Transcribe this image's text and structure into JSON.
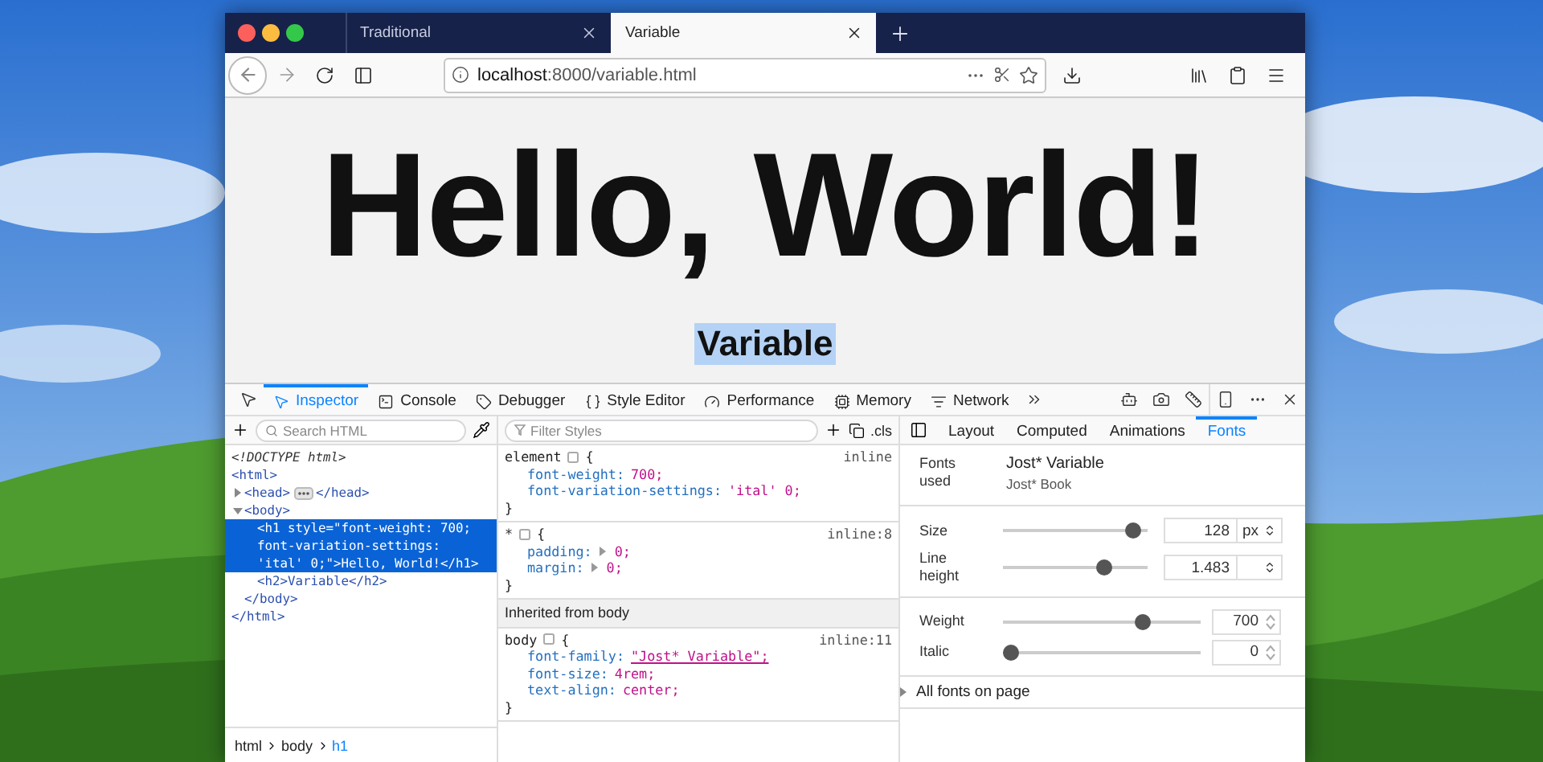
{
  "browser": {
    "tabs": [
      {
        "label": "Traditional",
        "selected": false
      },
      {
        "label": "Variable",
        "selected": true
      }
    ],
    "url": {
      "host": "localhost",
      "rest": ":8000/variable.html"
    }
  },
  "page": {
    "heading": "Hello, World!",
    "subheading": "Variable",
    "subheading_selected": true
  },
  "devtools": {
    "tools": [
      {
        "label": "Inspector",
        "selected": true
      },
      {
        "label": "Console",
        "selected": false
      },
      {
        "label": "Debugger",
        "selected": false
      },
      {
        "label": "Style Editor",
        "selected": false
      },
      {
        "label": "Performance",
        "selected": false
      },
      {
        "label": "Memory",
        "selected": false
      },
      {
        "label": "Network",
        "selected": false
      }
    ],
    "search_html": {
      "placeholder": "Search HTML"
    },
    "filter_styles": {
      "placeholder": "Filter Styles"
    },
    "cls": ".cls",
    "sidebar_tabs": [
      {
        "label": "Layout",
        "selected": false
      },
      {
        "label": "Computed",
        "selected": false
      },
      {
        "label": "Animations",
        "selected": false
      },
      {
        "label": "Fonts",
        "selected": true
      }
    ],
    "markup": [
      {
        "kind": "doctype",
        "open": "<!DOCTYPE html>",
        "selected": false
      },
      {
        "kind": "element",
        "open": "<html>",
        "close": "</html>",
        "selected": false,
        "children": [
          {
            "kind": "element",
            "open": "<head>",
            "close": "</head>",
            "selected": false,
            "expanded": false
          },
          {
            "kind": "element",
            "open": "<body>",
            "close": "</body>",
            "selected": false,
            "expanded": true,
            "children": [
              {
                "kind": "element",
                "open": "<h1 style=\"font-weight: 700; font-variation-settings: 'ital' 0;\">Hello, World!</h1>",
                "selected": true
              },
              {
                "kind": "element",
                "open": "<h2>Variable</h2>",
                "selected": false
              }
            ]
          }
        ]
      }
    ],
    "breadcrumbs": [
      {
        "label": "html",
        "selected": false
      },
      {
        "label": "body",
        "selected": false
      },
      {
        "label": "h1",
        "selected": true
      }
    ],
    "rules": [
      {
        "kind": "rule",
        "selector": "element",
        "open": "{",
        "close": "}",
        "source": "inline",
        "declarations": [
          {
            "kind": "plain",
            "property": "font-weight:",
            "value": "700;"
          },
          {
            "kind": "plain",
            "property": "font-variation-settings:",
            "value": "'ital' 0;"
          }
        ]
      },
      {
        "kind": "rule",
        "selector": "*",
        "open": "{",
        "close": "}",
        "source": "inline:8",
        "declarations": [
          {
            "kind": "shorthand",
            "property": "padding:",
            "value": "0;"
          },
          {
            "kind": "shorthand",
            "property": "margin:",
            "value": "0;"
          }
        ]
      },
      {
        "kind": "header",
        "label": "Inherited from body"
      },
      {
        "kind": "rule",
        "selector": "body",
        "open": "{",
        "close": "}",
        "source": "inline:11",
        "declarations": [
          {
            "kind": "font-link",
            "property": "font-family:",
            "value": "\"Jost* Variable\";"
          },
          {
            "kind": "plain",
            "property": "font-size:",
            "value": "4rem;"
          },
          {
            "kind": "plain",
            "property": "text-align:",
            "value": "center;"
          }
        ]
      }
    ],
    "fonts": {
      "used_label": "Fonts used",
      "name": "Jost* Variable",
      "subname": "Jost* Book",
      "groups": [
        [
          {
            "label": "Size",
            "level": 0.95,
            "value": "128",
            "kind": "unit",
            "unit": "px"
          },
          {
            "label": "Line height",
            "level": 0.73,
            "value": "1.483",
            "kind": "unit"
          }
        ],
        [
          {
            "label": "Weight",
            "level": 0.73,
            "value": "700",
            "kind": "spinner"
          },
          {
            "label": "Italic",
            "level": 0,
            "value": "0",
            "kind": "spinner"
          }
        ]
      ],
      "all_fonts": {
        "label": "All fonts on page",
        "expanded": false
      }
    }
  }
}
